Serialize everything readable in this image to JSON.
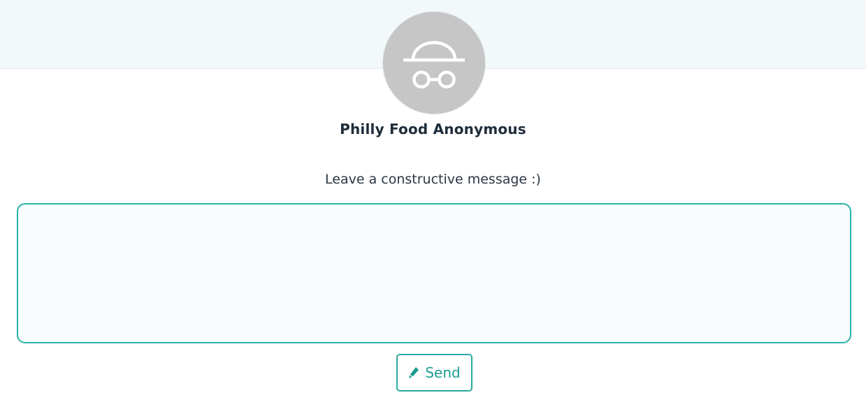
{
  "profile": {
    "avatar_icon": "incognito-hat-glasses-icon",
    "name": "Philly Food Anonymous"
  },
  "message": {
    "prompt": "Leave a constructive message :)",
    "value": "",
    "placeholder": ""
  },
  "send": {
    "icon": "pencil-icon",
    "label": "Send"
  },
  "colors": {
    "accent": "#2bb3a8",
    "header_band": "#f3f8fb",
    "avatar_bg": "#c6c6c6",
    "text_dark": "#1f2d3a"
  }
}
